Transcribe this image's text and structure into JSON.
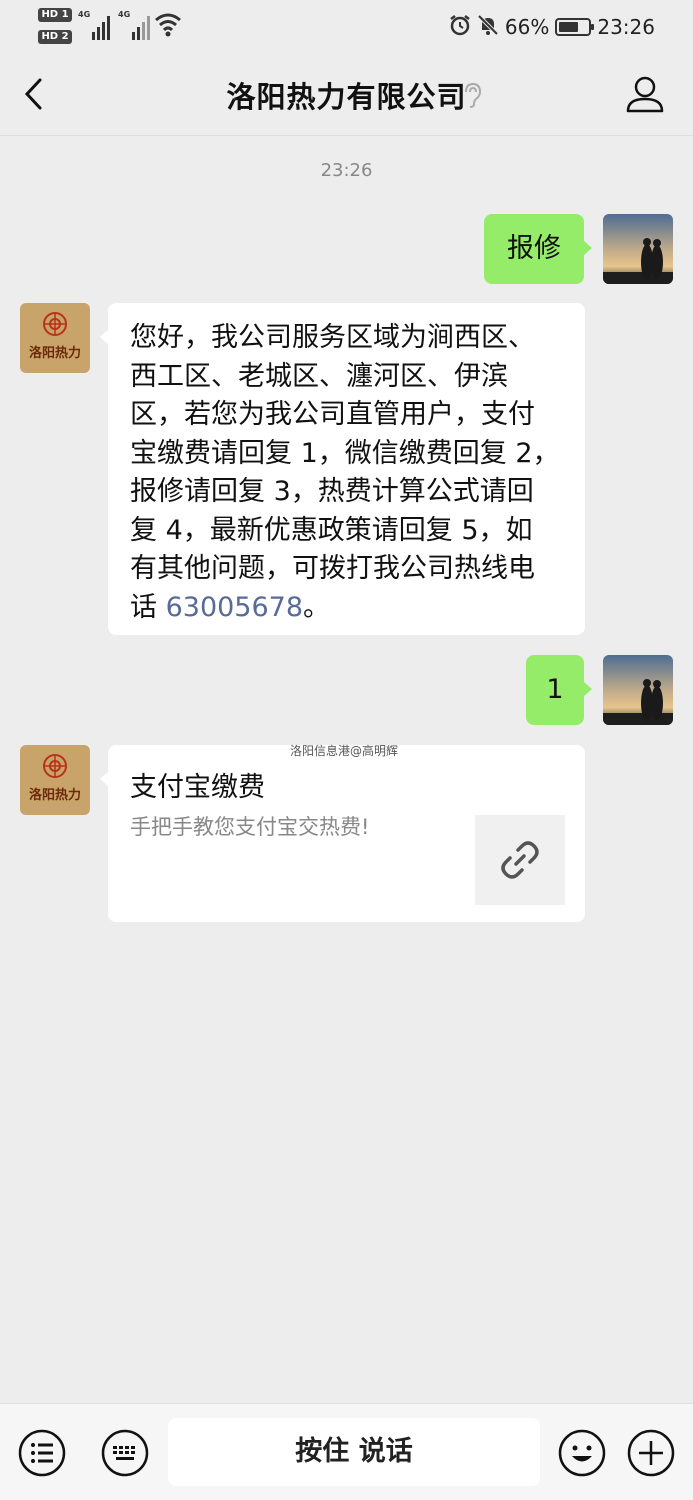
{
  "status_bar": {
    "hd1": "HD 1",
    "hd2": "HD 2",
    "net1": "4G",
    "net2": "4G",
    "battery_percent": "66%",
    "battery_level": 0.66,
    "time": "23:26",
    "icons": [
      "alarm-icon",
      "mute-icon",
      "wifi-icon",
      "battery-icon"
    ]
  },
  "nav": {
    "title": "洛阳热力有限公司",
    "icons": [
      "back-icon",
      "ear-icon",
      "profile-icon"
    ]
  },
  "chat": {
    "timestamp": "23:26",
    "messages": [
      {
        "from": "user",
        "text": "报修"
      },
      {
        "from": "company",
        "lines": [
          "您好，我公司服务区域为涧西区、",
          "西工区、老城区、瀍河区、伊滨",
          "区，若您为我公司直管用户，支付",
          "宝缴费请回复 1，微信缴费回复 2，",
          "报修请回复 3，热费计算公式请回",
          "复 4，最新优惠政策请回复 5，如",
          "有其他问题，可拨打我公司热线电"
        ],
        "last_prefix": "话 ",
        "phone": "63005678",
        "last_suffix": "。"
      },
      {
        "from": "user",
        "text": "1"
      },
      {
        "from": "company",
        "type": "link-card",
        "title": "支付宝缴费",
        "description": "手把手教您支付宝交热费!",
        "thumb_icon": "link-icon"
      }
    ],
    "company_avatar_text": "洛阳热力",
    "watermark": "洛阳信息港@高明辉"
  },
  "bottom_bar": {
    "hold_to_talk": "按住 说话",
    "icons": [
      "menu-icon",
      "keyboard-icon",
      "emoji-icon",
      "plus-icon"
    ]
  },
  "colors": {
    "background": "#ededed",
    "outgoing_bubble": "#95ec69",
    "incoming_bubble": "#ffffff",
    "link": "#576b95"
  }
}
